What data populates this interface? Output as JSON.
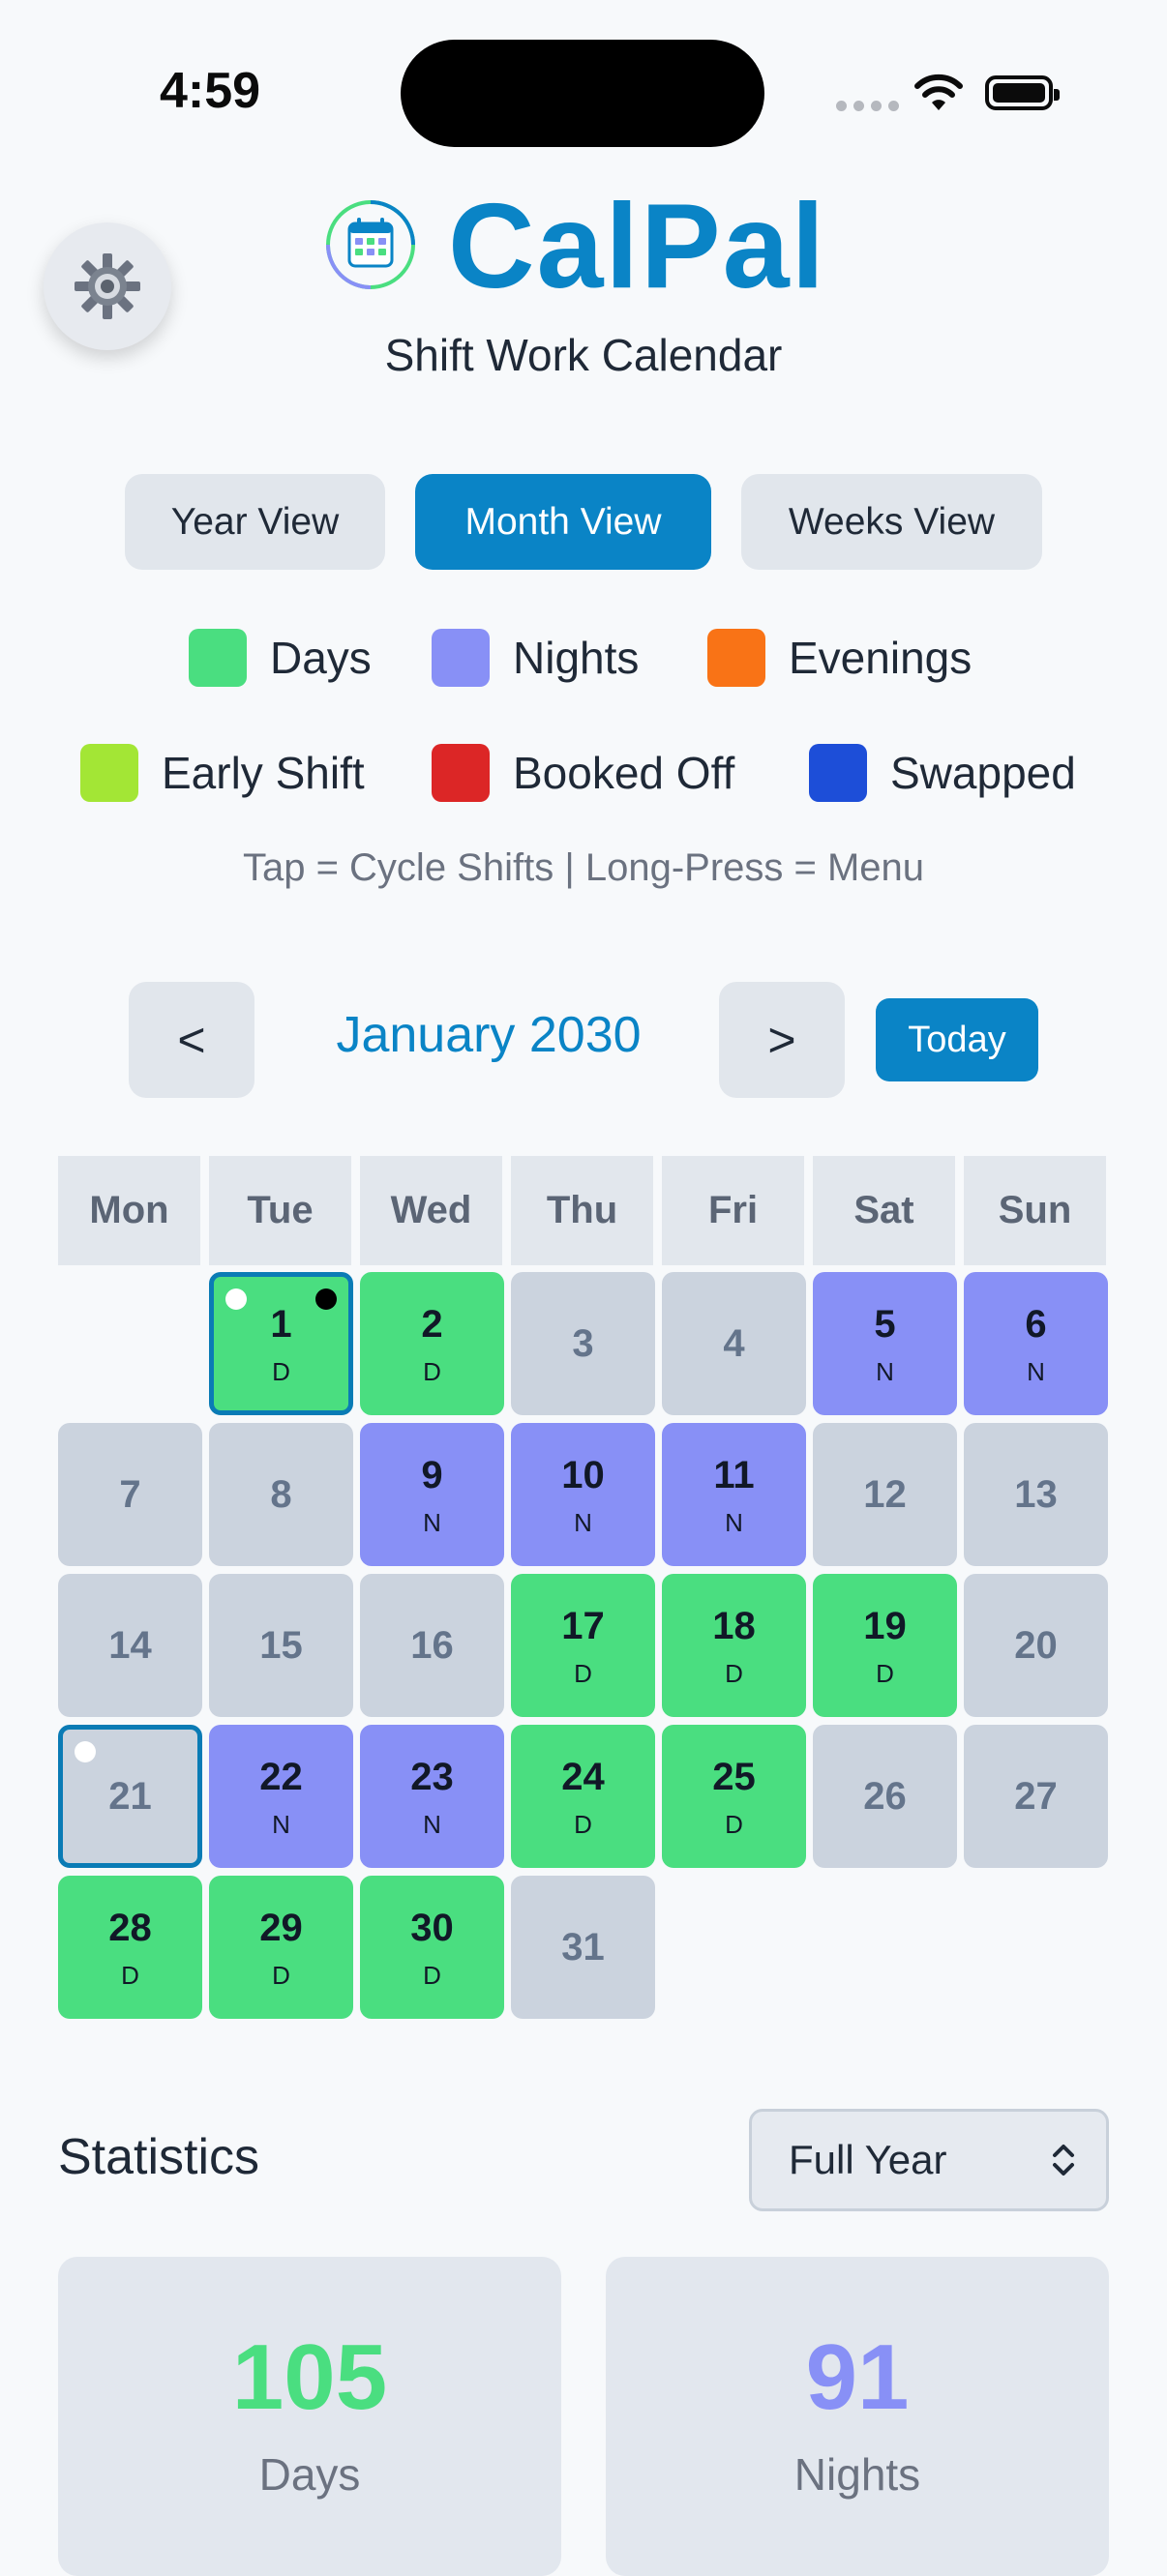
{
  "status_bar": {
    "time": "4:59"
  },
  "app": {
    "title": "CalPal",
    "subtitle": "Shift Work Calendar"
  },
  "views": {
    "year": "Year View",
    "month": "Month View",
    "weeks": "Weeks View",
    "active": "month"
  },
  "legend": [
    {
      "label": "Days",
      "color": "#4ade80"
    },
    {
      "label": "Nights",
      "color": "#8890f6"
    },
    {
      "label": "Evenings",
      "color": "#f97316"
    },
    {
      "label": "Early Shift",
      "color": "#a3e635"
    },
    {
      "label": "Booked Off",
      "color": "#dc2626"
    },
    {
      "label": "Swapped",
      "color": "#1d4ed8"
    }
  ],
  "hint": "Tap = Cycle Shifts | Long-Press = Menu",
  "calendar": {
    "prev": "<",
    "next": ">",
    "month_label": "January 2030",
    "today": "Today",
    "weekdays": [
      "Mon",
      "Tue",
      "Wed",
      "Thu",
      "Fri",
      "Sat",
      "Sun"
    ],
    "days": [
      {
        "n": "1",
        "shift": "D"
      },
      {
        "n": "2",
        "shift": "D"
      },
      {
        "n": "3",
        "shift": ""
      },
      {
        "n": "4",
        "shift": ""
      },
      {
        "n": "5",
        "shift": "N"
      },
      {
        "n": "6",
        "shift": "N"
      },
      {
        "n": "7",
        "shift": ""
      },
      {
        "n": "8",
        "shift": ""
      },
      {
        "n": "9",
        "shift": "N"
      },
      {
        "n": "10",
        "shift": "N"
      },
      {
        "n": "11",
        "shift": "N"
      },
      {
        "n": "12",
        "shift": ""
      },
      {
        "n": "13",
        "shift": ""
      },
      {
        "n": "14",
        "shift": ""
      },
      {
        "n": "15",
        "shift": ""
      },
      {
        "n": "16",
        "shift": ""
      },
      {
        "n": "17",
        "shift": "D"
      },
      {
        "n": "18",
        "shift": "D"
      },
      {
        "n": "19",
        "shift": "D"
      },
      {
        "n": "20",
        "shift": ""
      },
      {
        "n": "21",
        "shift": ""
      },
      {
        "n": "22",
        "shift": "N"
      },
      {
        "n": "23",
        "shift": "N"
      },
      {
        "n": "24",
        "shift": "D"
      },
      {
        "n": "25",
        "shift": "D"
      },
      {
        "n": "26",
        "shift": ""
      },
      {
        "n": "27",
        "shift": ""
      },
      {
        "n": "28",
        "shift": "D"
      },
      {
        "n": "29",
        "shift": "D"
      },
      {
        "n": "30",
        "shift": "D"
      },
      {
        "n": "31",
        "shift": ""
      }
    ]
  },
  "statistics": {
    "title": "Statistics",
    "period": "Full Year",
    "cards": [
      {
        "value": "105",
        "label": "Days",
        "color": "#4ade80"
      },
      {
        "value": "91",
        "label": "Nights",
        "color": "#8890f6"
      }
    ]
  }
}
